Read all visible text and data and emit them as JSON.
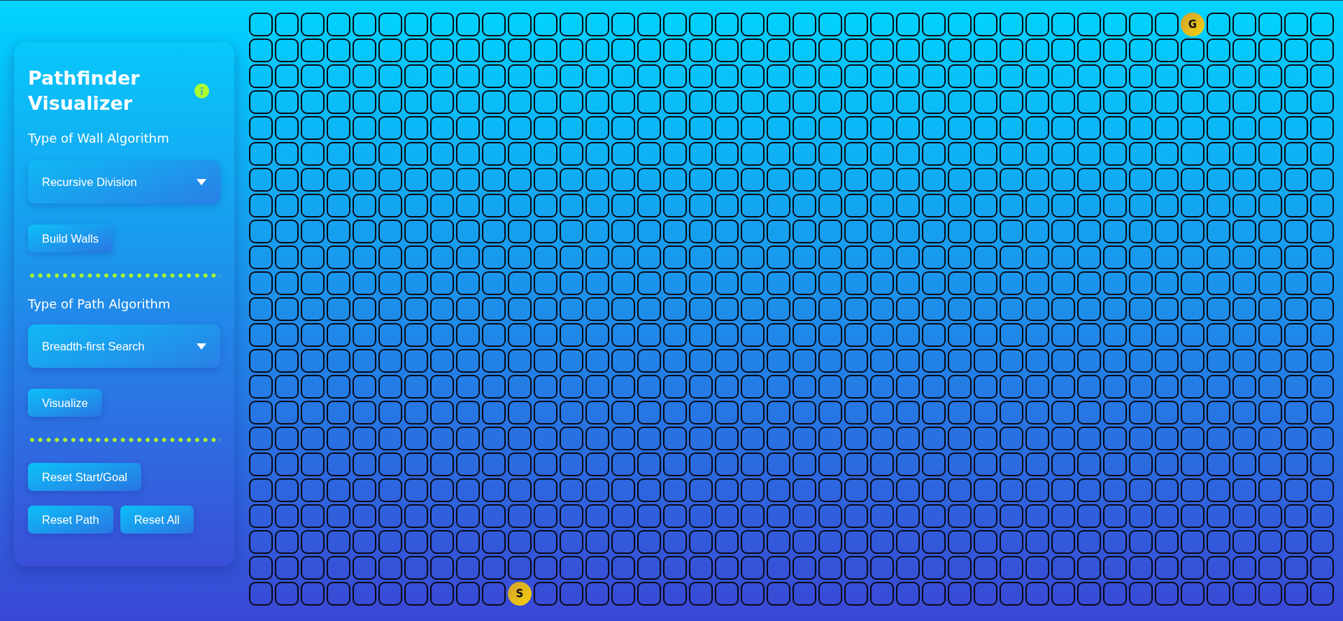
{
  "panel": {
    "title": "Pathfinder Visualizer",
    "wall_label": "Type of Wall Algorithm",
    "wall_select": {
      "value": "Recursive Division"
    },
    "build_button": "Build Walls",
    "path_label": "Type of Path Algorithm",
    "path_select": {
      "value": "Breadth-first Search"
    },
    "visualize_button": "Visualize",
    "reset_buttons": [
      "Reset Start/Goal",
      "Reset Path",
      "Reset All"
    ]
  },
  "grid": {
    "rows": [
      [
        null,
        null,
        null,
        null,
        null,
        null,
        null,
        null,
        null,
        null,
        null,
        null,
        null,
        null,
        null,
        null,
        null,
        null,
        null,
        null,
        null,
        null,
        null,
        null,
        null,
        null,
        null,
        null,
        null,
        null,
        null,
        null,
        null,
        null,
        null,
        null,
        {
          "label": "G"
        },
        null,
        null,
        null,
        null,
        null
      ],
      [
        null,
        null,
        null,
        null,
        null,
        null,
        null,
        null,
        null,
        null,
        null,
        null,
        null,
        null,
        null,
        null,
        null,
        null,
        null,
        null,
        null,
        null,
        null,
        null,
        null,
        null,
        null,
        null,
        null,
        null,
        null,
        null,
        null,
        null,
        null,
        null,
        null,
        null,
        null,
        null,
        null,
        null
      ],
      [
        null,
        null,
        null,
        null,
        null,
        null,
        null,
        null,
        null,
        null,
        null,
        null,
        null,
        null,
        null,
        null,
        null,
        null,
        null,
        null,
        null,
        null,
        null,
        null,
        null,
        null,
        null,
        null,
        null,
        null,
        null,
        null,
        null,
        null,
        null,
        null,
        null,
        null,
        null,
        null,
        null,
        null
      ],
      [
        null,
        null,
        null,
        null,
        null,
        null,
        null,
        null,
        null,
        null,
        null,
        null,
        null,
        null,
        null,
        null,
        null,
        null,
        null,
        null,
        null,
        null,
        null,
        null,
        null,
        null,
        null,
        null,
        null,
        null,
        null,
        null,
        null,
        null,
        null,
        null,
        null,
        null,
        null,
        null,
        null,
        null
      ],
      [
        null,
        null,
        null,
        null,
        null,
        null,
        null,
        null,
        null,
        null,
        null,
        null,
        null,
        null,
        null,
        null,
        null,
        null,
        null,
        null,
        null,
        null,
        null,
        null,
        null,
        null,
        null,
        null,
        null,
        null,
        null,
        null,
        null,
        null,
        null,
        null,
        null,
        null,
        null,
        null,
        null,
        null
      ],
      [
        null,
        null,
        null,
        null,
        null,
        null,
        null,
        null,
        null,
        null,
        null,
        null,
        null,
        null,
        null,
        null,
        null,
        null,
        null,
        null,
        null,
        null,
        null,
        null,
        null,
        null,
        null,
        null,
        null,
        null,
        null,
        null,
        null,
        null,
        null,
        null,
        null,
        null,
        null,
        null,
        null,
        null
      ],
      [
        null,
        null,
        null,
        null,
        null,
        null,
        null,
        null,
        null,
        null,
        null,
        null,
        null,
        null,
        null,
        null,
        null,
        null,
        null,
        null,
        null,
        null,
        null,
        null,
        null,
        null,
        null,
        null,
        null,
        null,
        null,
        null,
        null,
        null,
        null,
        null,
        null,
        null,
        null,
        null,
        null,
        null
      ],
      [
        null,
        null,
        null,
        null,
        null,
        null,
        null,
        null,
        null,
        null,
        null,
        null,
        null,
        null,
        null,
        null,
        null,
        null,
        null,
        null,
        null,
        null,
        null,
        null,
        null,
        null,
        null,
        null,
        null,
        null,
        null,
        null,
        null,
        null,
        null,
        null,
        null,
        null,
        null,
        null,
        null,
        null
      ],
      [
        null,
        null,
        null,
        null,
        null,
        null,
        null,
        null,
        null,
        null,
        null,
        null,
        null,
        null,
        null,
        null,
        null,
        null,
        null,
        null,
        null,
        null,
        null,
        null,
        null,
        null,
        null,
        null,
        null,
        null,
        null,
        null,
        null,
        null,
        null,
        null,
        null,
        null,
        null,
        null,
        null,
        null
      ],
      [
        null,
        null,
        null,
        null,
        null,
        null,
        null,
        null,
        null,
        null,
        null,
        null,
        null,
        null,
        null,
        null,
        null,
        null,
        null,
        null,
        null,
        null,
        null,
        null,
        null,
        null,
        null,
        null,
        null,
        null,
        null,
        null,
        null,
        null,
        null,
        null,
        null,
        null,
        null,
        null,
        null,
        null
      ],
      [
        null,
        null,
        null,
        null,
        null,
        null,
        null,
        null,
        null,
        null,
        null,
        null,
        null,
        null,
        null,
        null,
        null,
        null,
        null,
        null,
        null,
        null,
        null,
        null,
        null,
        null,
        null,
        null,
        null,
        null,
        null,
        null,
        null,
        null,
        null,
        null,
        null,
        null,
        null,
        null,
        null,
        null
      ],
      [
        null,
        null,
        null,
        null,
        null,
        null,
        null,
        null,
        null,
        null,
        null,
        null,
        null,
        null,
        null,
        null,
        null,
        null,
        null,
        null,
        null,
        null,
        null,
        null,
        null,
        null,
        null,
        null,
        null,
        null,
        null,
        null,
        null,
        null,
        null,
        null,
        null,
        null,
        null,
        null,
        null,
        null
      ],
      [
        null,
        null,
        null,
        null,
        null,
        null,
        null,
        null,
        null,
        null,
        null,
        null,
        null,
        null,
        null,
        null,
        null,
        null,
        null,
        null,
        null,
        null,
        null,
        null,
        null,
        null,
        null,
        null,
        null,
        null,
        null,
        null,
        null,
        null,
        null,
        null,
        null,
        null,
        null,
        null,
        null,
        null
      ],
      [
        null,
        null,
        null,
        null,
        null,
        null,
        null,
        null,
        null,
        null,
        null,
        null,
        null,
        null,
        null,
        null,
        null,
        null,
        null,
        null,
        null,
        null,
        null,
        null,
        null,
        null,
        null,
        null,
        null,
        null,
        null,
        null,
        null,
        null,
        null,
        null,
        null,
        null,
        null,
        null,
        null,
        null
      ],
      [
        null,
        null,
        null,
        null,
        null,
        null,
        null,
        null,
        null,
        null,
        null,
        null,
        null,
        null,
        null,
        null,
        null,
        null,
        null,
        null,
        null,
        null,
        null,
        null,
        null,
        null,
        null,
        null,
        null,
        null,
        null,
        null,
        null,
        null,
        null,
        null,
        null,
        null,
        null,
        null,
        null,
        null
      ],
      [
        null,
        null,
        null,
        null,
        null,
        null,
        null,
        null,
        null,
        null,
        null,
        null,
        null,
        null,
        null,
        null,
        null,
        null,
        null,
        null,
        null,
        null,
        null,
        null,
        null,
        null,
        null,
        null,
        null,
        null,
        null,
        null,
        null,
        null,
        null,
        null,
        null,
        null,
        null,
        null,
        null,
        null
      ],
      [
        null,
        null,
        null,
        null,
        null,
        null,
        null,
        null,
        null,
        null,
        null,
        null,
        null,
        null,
        null,
        null,
        null,
        null,
        null,
        null,
        null,
        null,
        null,
        null,
        null,
        null,
        null,
        null,
        null,
        null,
        null,
        null,
        null,
        null,
        null,
        null,
        null,
        null,
        null,
        null,
        null,
        null
      ],
      [
        null,
        null,
        null,
        null,
        null,
        null,
        null,
        null,
        null,
        null,
        null,
        null,
        null,
        null,
        null,
        null,
        null,
        null,
        null,
        null,
        null,
        null,
        null,
        null,
        null,
        null,
        null,
        null,
        null,
        null,
        null,
        null,
        null,
        null,
        null,
        null,
        null,
        null,
        null,
        null,
        null,
        null
      ],
      [
        null,
        null,
        null,
        null,
        null,
        null,
        null,
        null,
        null,
        null,
        null,
        null,
        null,
        null,
        null,
        null,
        null,
        null,
        null,
        null,
        null,
        null,
        null,
        null,
        null,
        null,
        null,
        null,
        null,
        null,
        null,
        null,
        null,
        null,
        null,
        null,
        null,
        null,
        null,
        null,
        null,
        null
      ],
      [
        null,
        null,
        null,
        null,
        null,
        null,
        null,
        null,
        null,
        null,
        null,
        null,
        null,
        null,
        null,
        null,
        null,
        null,
        null,
        null,
        null,
        null,
        null,
        null,
        null,
        null,
        null,
        null,
        null,
        null,
        null,
        null,
        null,
        null,
        null,
        null,
        null,
        null,
        null,
        null,
        null,
        null
      ],
      [
        null,
        null,
        null,
        null,
        null,
        null,
        null,
        null,
        null,
        null,
        null,
        null,
        null,
        null,
        null,
        null,
        null,
        null,
        null,
        null,
        null,
        null,
        null,
        null,
        null,
        null,
        null,
        null,
        null,
        null,
        null,
        null,
        null,
        null,
        null,
        null,
        null,
        null,
        null,
        null,
        null,
        null
      ],
      [
        null,
        null,
        null,
        null,
        null,
        null,
        null,
        null,
        null,
        null,
        null,
        null,
        null,
        null,
        null,
        null,
        null,
        null,
        null,
        null,
        null,
        null,
        null,
        null,
        null,
        null,
        null,
        null,
        null,
        null,
        null,
        null,
        null,
        null,
        null,
        null,
        null,
        null,
        null,
        null,
        null,
        null
      ],
      [
        null,
        null,
        null,
        null,
        null,
        null,
        null,
        null,
        null,
        null,
        {
          "label": "S"
        },
        null,
        null,
        null,
        null,
        null,
        null,
        null,
        null,
        null,
        null,
        null,
        null,
        null,
        null,
        null,
        null,
        null,
        null,
        null,
        null,
        null,
        null,
        null,
        null,
        null,
        null,
        null,
        null,
        null,
        null,
        null
      ]
    ]
  }
}
